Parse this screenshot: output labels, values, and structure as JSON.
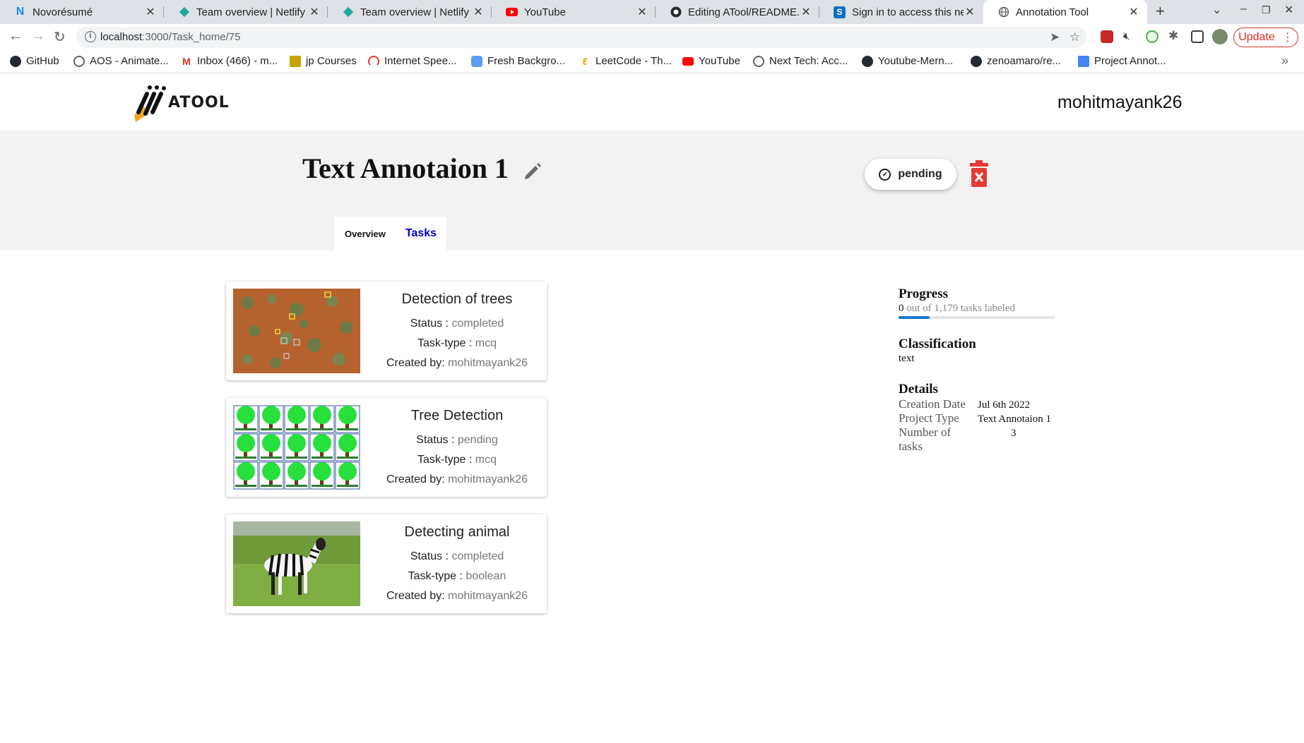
{
  "browser": {
    "tabs": [
      {
        "title": "Novorésumé",
        "icon": "novoresume-icon"
      },
      {
        "title": "Team overview | Netlify",
        "icon": "netlify-icon"
      },
      {
        "title": "Team overview | Netlify",
        "icon": "netlify-icon"
      },
      {
        "title": "YouTube",
        "icon": "youtube-icon"
      },
      {
        "title": "Editing ATool/README.r",
        "icon": "github-icon"
      },
      {
        "title": "Sign in to access this net",
        "icon": "s-icon"
      },
      {
        "title": "Annotation Tool",
        "icon": "globe-icon"
      }
    ],
    "url_host": "localhost",
    "url_path": ":3000/Task_home/75",
    "update_label": "Update",
    "bookmarks": [
      "GitHub",
      "AOS - Animate...",
      "Inbox (466) - m...",
      "jp Courses",
      "Internet Spee...",
      "Fresh Backgro...",
      "LeetCode - Th...",
      "YouTube",
      "Next Tech: Acc...",
      "Youtube-Mern...",
      "zenoamaro/re...",
      "Project Annot..."
    ]
  },
  "app": {
    "logo_text": "ATOOL",
    "username": "mohitmayank26",
    "project_title": "Text Annotaion 1",
    "status": "pending",
    "tabs": [
      "Overview",
      "Tasks"
    ]
  },
  "tasks": [
    {
      "name": "Detection of trees",
      "status_label": "Status :",
      "status": "completed",
      "type_label": "Task-type :",
      "type": "mcq",
      "created_label": "Created by:",
      "created_by": "mohitmayank26"
    },
    {
      "name": "Tree Detection",
      "status_label": "Status :",
      "status": "pending",
      "type_label": "Task-type :",
      "type": "mcq",
      "created_label": "Created by:",
      "created_by": "mohitmayank26"
    },
    {
      "name": "Detecting animal",
      "status_label": "Status :",
      "status": "completed",
      "type_label": "Task-type :",
      "type": "boolean",
      "created_label": "Created by:",
      "created_by": "mohitmayank26"
    }
  ],
  "sidebar": {
    "progress_heading": "Progress",
    "progress_labeled": "0",
    "progress_text": "out of 1,179 tasks labeled",
    "progress_fraction": 0.2,
    "classification_heading": "Classification",
    "classification": "text",
    "details_heading": "Details",
    "details": [
      {
        "key": "Creation Date",
        "value": "Jul 6th 2022"
      },
      {
        "key": "Project Type",
        "value": "Text Annotaion 1"
      },
      {
        "key": "Number of tasks",
        "value": "3"
      }
    ]
  },
  "colors": {
    "accent_blue": "#1976d2",
    "delete_red": "#e53935",
    "tab_link_blue": "#0000cc"
  }
}
